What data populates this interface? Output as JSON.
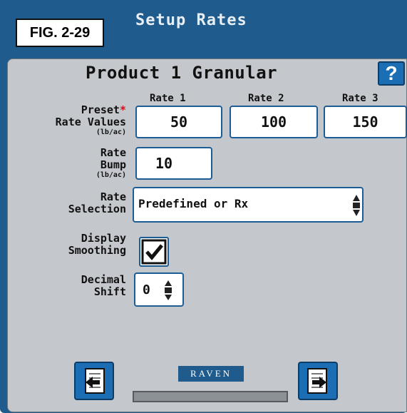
{
  "figure_label": "FIG. 2-29",
  "screen_title": "Setup Rates",
  "product_title": "Product 1 Granular",
  "help_label": "?",
  "rate_columns": [
    "Rate 1",
    "Rate 2",
    "Rate 3"
  ],
  "preset": {
    "label_line1": "Preset",
    "required_mark": "*",
    "label_line2": "Rate Values",
    "unit": "(lb/ac)",
    "values": [
      "50",
      "100",
      "150"
    ]
  },
  "rate_bump": {
    "label_line1": "Rate",
    "label_line2": "Bump",
    "unit": "(lb/ac)",
    "value": "10"
  },
  "rate_selection": {
    "label_line1": "Rate",
    "label_line2": "Selection",
    "value": "Predefined or Rx"
  },
  "display_smoothing": {
    "label_line1": "Display",
    "label_line2": "Smoothing",
    "checked": true
  },
  "decimal_shift": {
    "label_line1": "Decimal",
    "label_line2": "Shift",
    "value": "0"
  },
  "footer": {
    "logo_text": "RAVEN",
    "back_icon": "back-arrow-icon",
    "next_icon": "next-arrow-icon"
  },
  "colors": {
    "header_blue": "#1f5b8c",
    "panel_gray": "#c4c8cc",
    "button_blue": "#1b6eb3",
    "required_red": "#d0111b"
  }
}
